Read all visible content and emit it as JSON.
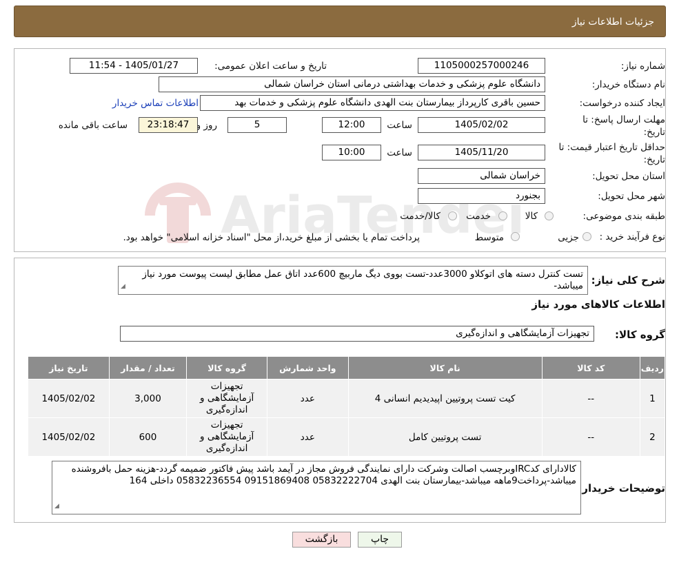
{
  "header": {
    "title": "جزئیات اطلاعات نیاز"
  },
  "form": {
    "need_number_label": "شماره نیاز:",
    "need_number": "1105000257000246",
    "announce_label": "تاریخ و ساعت اعلان عمومی:",
    "announce_value": "1405/01/27 - 11:54",
    "buyer_org_label": "نام دستگاه خریدار:",
    "buyer_org": "دانشگاه علوم پزشکی و خدمات بهداشتی درمانی استان خراسان شمالی",
    "requester_label": "ایجاد کننده درخواست:",
    "requester": "حسین باقری کارپرداز بیمارستان بنت الهدی دانشگاه علوم پزشکی و خدمات بهد",
    "contact_link": "اطلاعات تماس خریدار",
    "reply_deadline_label_1": "مهلت ارسال پاسخ: تا",
    "reply_deadline_label_2": "تاریخ:",
    "reply_date": "1405/02/02",
    "time_label": "ساعت",
    "reply_time": "12:00",
    "days_value": "5",
    "days_label": "روز و",
    "remaining_time": "23:18:47",
    "remaining_label": "ساعت باقی مانده",
    "validity_label_1": "حداقل تاریخ اعتبار قیمت: تا",
    "validity_label_2": "تاریخ:",
    "validity_date": "1405/11/20",
    "validity_time_label": "ساعت",
    "validity_time": "10:00",
    "province_label": "استان محل تحویل:",
    "province": "خراسان شمالی",
    "city_label": "شهر محل تحویل:",
    "city": "بجنورد",
    "category_label": "طبقه بندی موضوعی:",
    "category_options": [
      "کالا",
      "خدمت",
      "کالا/خدمت"
    ],
    "process_label": "نوع فرآیند خرید :",
    "process_options": [
      "جزیی",
      "متوسط"
    ],
    "process_note": "پرداخت تمام یا بخشی از مبلغ خرید،از محل \"اسناد خزانه اسلامی\" خواهد بود."
  },
  "summary": {
    "label": "شرح کلی نیاز:",
    "text": "تست کنترل دسته های اتوکلاو 3000عدد-تست بووی دیگ ماربیچ 600عدد اتاق عمل مطابق لیست پیوست مورد نیاز میباشد-",
    "goods_info_title": "اطلاعات کالاهای مورد نیاز",
    "goods_group_label": "گروه کالا:",
    "goods_group": "تجهیزات آزمایشگاهی و اندازه‌گیری"
  },
  "table": {
    "headers": [
      "ردیف",
      "کد کالا",
      "نام کالا",
      "واحد شمارش",
      "گروه کالا",
      "تعداد / مقدار",
      "تاریخ نیاز"
    ],
    "rows": [
      [
        "1",
        "--",
        "کیت تست پروتیین اپیدیدیم انسانی 4",
        "عدد",
        "تجهیزات آزمایشگاهی و اندازه‌گیری",
        "3,000",
        "1405/02/02"
      ],
      [
        "2",
        "--",
        "تست پروتیین کامل",
        "عدد",
        "تجهیزات آزمایشگاهی و اندازه‌گیری",
        "600",
        "1405/02/02"
      ]
    ]
  },
  "buyer_notes": {
    "label": "توضیحات خریدار:",
    "text": "کالادارای کدIRCوبرچسب اصالت وشرکت دارای نمایندگی فروش مجاز در آیمد باشد پیش فاکتور ضمیمه گردد-هزینه حمل بافروشنده میباشد-پرداخت9ماهه میباشد-بیمارستان بنت الهدی 05832222704 09151869408 05832236554  داخلی 164"
  },
  "buttons": {
    "print": "چاپ",
    "back": "بازگشت"
  },
  "watermark": {
    "text": "AriaTender.neT"
  }
}
